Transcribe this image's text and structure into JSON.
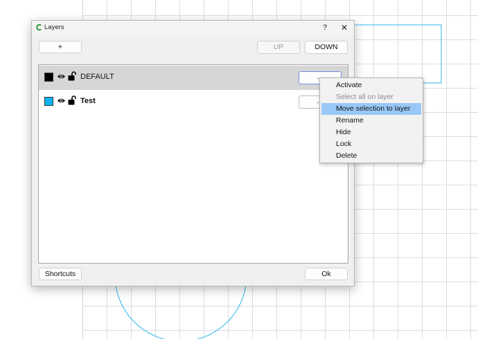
{
  "dialog": {
    "title": "Layers",
    "help_label": "?",
    "close_label": "✕",
    "add_label": "+",
    "up_label": "UP",
    "down_label": "DOWN",
    "shortcuts_label": "Shortcuts",
    "ok_label": "Ok"
  },
  "layers": [
    {
      "name": "DEFAULT",
      "color": "#000000",
      "visible_icon": "eye-icon",
      "lock_icon": "unlocked-icon",
      "selected": true,
      "options_label": "..."
    },
    {
      "name": "Test",
      "color": "#10b4f0",
      "visible_icon": "eye-icon",
      "lock_icon": "unlocked-icon",
      "selected": false,
      "options_label": "..."
    }
  ],
  "context_menu": {
    "items": [
      {
        "label": "Activate",
        "state": "normal"
      },
      {
        "label": "Select all on layer",
        "state": "disabled"
      },
      {
        "label": "Move selection to layer",
        "state": "highlighted"
      },
      {
        "label": "Rename",
        "state": "normal"
      },
      {
        "label": "Hide",
        "state": "normal"
      },
      {
        "label": "Lock",
        "state": "normal"
      },
      {
        "label": "Delete",
        "state": "normal"
      }
    ]
  },
  "colors": {
    "grid_line": "#d9dde2",
    "shape_outline": "#29b6ec",
    "menu_highlight": "#99c8f7",
    "selected_row": "#d6d6d6"
  }
}
